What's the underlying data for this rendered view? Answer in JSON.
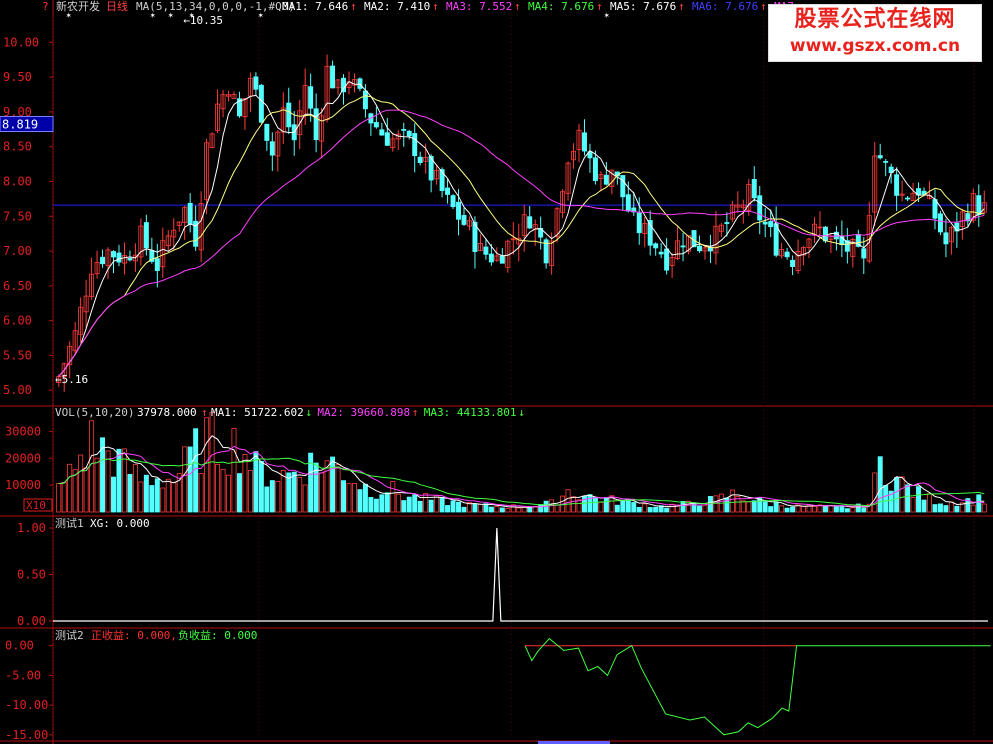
{
  "header": {
    "stock_name": "新农开发",
    "period": "日线",
    "ma_def": "MA(5,13,34,0,0,0,-1,#Q0)",
    "ma_items": [
      {
        "text": "MA1: 7.646",
        "arrow": "↑",
        "color": "#ffffff"
      },
      {
        "text": "MA2: 7.410",
        "arrow": "↑",
        "color": "#ffffff"
      },
      {
        "text": "MA3: 7.552",
        "arrow": "↑",
        "color": "#ff40ff"
      },
      {
        "text": "MA4: 7.676",
        "arrow": "↑",
        "color": "#40ff40"
      },
      {
        "text": "MA5: 7.676",
        "arrow": "↑",
        "color": "#ffffff"
      },
      {
        "text": "MA6: 7.676",
        "arrow": "↑",
        "color": "#4040ff"
      },
      {
        "text": "MA7",
        "arrow": "",
        "color": "#ff40ff"
      }
    ]
  },
  "watermark": {
    "line1": "股票公式在线网",
    "line2": "www.gszx.com.cn"
  },
  "price_panel": {
    "ticks": [
      "10.00",
      "9.50",
      "9.00",
      "8.50",
      "8.00",
      "7.50",
      "7.00",
      "6.50",
      "6.00",
      "5.50",
      "5.00"
    ],
    "tick_values": [
      10.0,
      9.5,
      9.0,
      8.5,
      8.0,
      7.5,
      7.0,
      6.5,
      6.0,
      5.5,
      5.0
    ],
    "ylim": [
      4.96,
      10.35
    ],
    "current_price_label": "8.819",
    "current_price": 8.819,
    "hline_price": 7.66,
    "high_label": "10.35",
    "low_label": "5.16"
  },
  "vol_panel": {
    "title": "VOL(5,10,20)",
    "value": "37978.000",
    "items": [
      {
        "text": "MA1: 51722.602",
        "arrow": "↓",
        "color": "#ffffff"
      },
      {
        "text": "MA2: 39660.898",
        "arrow": "↑",
        "color": "#ff40ff"
      },
      {
        "text": "MA3: 44133.801",
        "arrow": "↓",
        "color": "#40ff40"
      }
    ],
    "ticks": [
      "30000",
      "20000",
      "10000"
    ],
    "tick_values": [
      30000,
      20000,
      10000
    ],
    "ylim": [
      0,
      33500
    ],
    "unit_badge": "X10"
  },
  "test1_panel": {
    "title": "测试1",
    "item": "XG: 0.000",
    "ticks": [
      "1.00",
      "0.50",
      "0.00"
    ],
    "tick_values": [
      1.0,
      0.5,
      0.0
    ],
    "ylim": [
      0,
      1.0
    ]
  },
  "test2_panel": {
    "title": "测试2",
    "pos_label": "正收益: 0.000,",
    "neg_label": "负收益: 0.000",
    "ticks": [
      "0.00",
      "-5.00",
      "-10.00",
      "-15.00"
    ],
    "tick_values": [
      0,
      -5,
      -10,
      -15
    ],
    "ylim": [
      -15.2,
      1.3
    ]
  },
  "chart_data": {
    "type": "candlestick",
    "n_bars": 170,
    "anchors": [
      [
        0,
        5.2
      ],
      [
        3,
        5.8
      ],
      [
        6,
        6.8
      ],
      [
        9,
        7.0
      ],
      [
        12,
        6.9
      ],
      [
        15,
        7.2
      ],
      [
        18,
        6.8
      ],
      [
        21,
        7.4
      ],
      [
        23,
        7.6
      ],
      [
        25,
        7.2
      ],
      [
        27,
        8.5
      ],
      [
        29,
        9.1
      ],
      [
        31,
        9.4
      ],
      [
        33,
        8.9
      ],
      [
        35,
        9.5
      ],
      [
        37,
        9.0
      ],
      [
        39,
        8.4
      ],
      [
        41,
        9.0
      ],
      [
        43,
        8.6
      ],
      [
        45,
        9.4
      ],
      [
        47,
        8.6
      ],
      [
        49,
        9.6
      ],
      [
        51,
        9.3
      ],
      [
        53,
        9.5
      ],
      [
        55,
        9.2
      ],
      [
        57,
        8.9
      ],
      [
        59,
        8.7
      ],
      [
        61,
        8.6
      ],
      [
        63,
        8.6
      ],
      [
        65,
        8.5
      ],
      [
        67,
        8.2
      ],
      [
        69,
        8.0
      ],
      [
        71,
        7.7
      ],
      [
        73,
        7.5
      ],
      [
        75,
        7.3
      ],
      [
        77,
        7.0
      ],
      [
        80,
        6.9
      ],
      [
        83,
        7.2
      ],
      [
        86,
        7.5
      ],
      [
        89,
        7.0
      ],
      [
        91,
        7.6
      ],
      [
        93,
        8.4
      ],
      [
        95,
        8.6
      ],
      [
        97,
        8.3
      ],
      [
        99,
        8.0
      ],
      [
        101,
        8.2
      ],
      [
        103,
        7.8
      ],
      [
        105,
        7.4
      ],
      [
        108,
        7.2
      ],
      [
        111,
        6.9
      ],
      [
        114,
        7.2
      ],
      [
        117,
        7.1
      ],
      [
        120,
        7.2
      ],
      [
        123,
        7.5
      ],
      [
        126,
        7.8
      ],
      [
        128,
        7.5
      ],
      [
        131,
        7.1
      ],
      [
        134,
        6.9
      ],
      [
        136,
        7.2
      ],
      [
        139,
        7.3
      ],
      [
        142,
        7.1
      ],
      [
        145,
        7.0
      ],
      [
        147,
        6.8
      ],
      [
        149,
        8.5
      ],
      [
        151,
        8.2
      ],
      [
        154,
        7.8
      ],
      [
        157,
        7.9
      ],
      [
        160,
        7.5
      ],
      [
        162,
        7.1
      ],
      [
        165,
        7.5
      ],
      [
        167,
        7.7
      ],
      [
        169,
        7.6
      ]
    ],
    "volume_anchors": [
      [
        0,
        8000
      ],
      [
        3,
        17000
      ],
      [
        6,
        26000
      ],
      [
        9,
        22000
      ],
      [
        12,
        17000
      ],
      [
        15,
        12000
      ],
      [
        18,
        13000
      ],
      [
        21,
        12000
      ],
      [
        24,
        20000
      ],
      [
        27,
        27000
      ],
      [
        30,
        24000
      ],
      [
        33,
        25000
      ],
      [
        36,
        16000
      ],
      [
        39,
        14000
      ],
      [
        42,
        14000
      ],
      [
        45,
        17000
      ],
      [
        48,
        19000
      ],
      [
        51,
        17000
      ],
      [
        54,
        12000
      ],
      [
        57,
        8000
      ],
      [
        60,
        9000
      ],
      [
        63,
        6000
      ],
      [
        66,
        5000
      ],
      [
        70,
        4000
      ],
      [
        75,
        2600
      ],
      [
        80,
        2000
      ],
      [
        85,
        2000
      ],
      [
        90,
        3200
      ],
      [
        93,
        8000
      ],
      [
        96,
        6000
      ],
      [
        99,
        5000
      ],
      [
        102,
        4000
      ],
      [
        106,
        3000
      ],
      [
        110,
        2000
      ],
      [
        115,
        3000
      ],
      [
        120,
        4500
      ],
      [
        123,
        6500
      ],
      [
        126,
        5000
      ],
      [
        130,
        3000
      ],
      [
        135,
        2200
      ],
      [
        140,
        1800
      ],
      [
        145,
        1600
      ],
      [
        148,
        3000
      ],
      [
        150,
        18000
      ],
      [
        153,
        12000
      ],
      [
        156,
        7500
      ],
      [
        159,
        5000
      ],
      [
        162,
        3500
      ],
      [
        165,
        4000
      ],
      [
        169,
        5000
      ]
    ],
    "profit_curve": [
      [
        0,
        0
      ],
      [
        0.7,
        -2.5
      ],
      [
        1.3,
        -1
      ],
      [
        2.5,
        1.2
      ],
      [
        4,
        -0.8
      ],
      [
        5.5,
        -0.4
      ],
      [
        6.5,
        -4.2
      ],
      [
        7.5,
        -3.5
      ],
      [
        8.5,
        -5
      ],
      [
        9.5,
        -1.5
      ],
      [
        11,
        0
      ],
      [
        12,
        -3.8
      ],
      [
        14.5,
        -11.5
      ],
      [
        17,
        -12.5
      ],
      [
        18.5,
        -12
      ],
      [
        19.5,
        -13.5
      ],
      [
        20.5,
        -15
      ],
      [
        22,
        -14.5
      ],
      [
        23,
        -13
      ],
      [
        24,
        -13.8
      ],
      [
        25.5,
        -12.2
      ],
      [
        26.5,
        -10.5
      ],
      [
        27.2,
        -11
      ],
      [
        28,
        0
      ],
      [
        48,
        0
      ]
    ]
  }
}
